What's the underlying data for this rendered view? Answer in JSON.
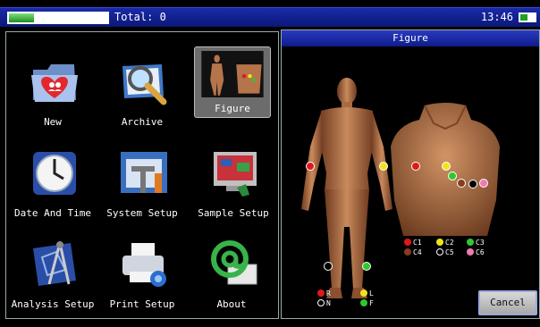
{
  "statusbar": {
    "total_label": "Total: 0",
    "time": "13:46",
    "progress": 0.25,
    "battery_level": 0.5
  },
  "menu": {
    "items": [
      {
        "label": "New",
        "icon": "folder-heart-icon"
      },
      {
        "label": "Archive",
        "icon": "magnifier-folder-icon"
      },
      {
        "label": "Figure",
        "icon": "electrode-figure-icon",
        "selected": true
      },
      {
        "label": "Date And Time",
        "icon": "clock-icon"
      },
      {
        "label": "System Setup",
        "icon": "tools-icon"
      },
      {
        "label": "Sample Setup",
        "icon": "sample-monitor-icon"
      },
      {
        "label": "Analysis Setup",
        "icon": "compass-blueprint-icon"
      },
      {
        "label": "Print Setup",
        "icon": "printer-gear-icon"
      },
      {
        "label": "About",
        "icon": "at-sign-icon"
      }
    ]
  },
  "figure_panel": {
    "title": "Figure",
    "cancel_label": "Cancel",
    "limb_legend": [
      {
        "label": "R",
        "color": "#e01818"
      },
      {
        "label": "L",
        "color": "#f2e21a"
      },
      {
        "label": "N",
        "color": "#000000"
      },
      {
        "label": "F",
        "color": "#2ec82e"
      }
    ],
    "chest_legend": [
      {
        "label": "C1",
        "color": "#e01818"
      },
      {
        "label": "C2",
        "color": "#f2e21a"
      },
      {
        "label": "C3",
        "color": "#2ec82e"
      },
      {
        "label": "C4",
        "color": "#8a3a20"
      },
      {
        "label": "C5",
        "color": "#000000"
      },
      {
        "label": "C6",
        "color": "#f07ab0"
      }
    ]
  }
}
